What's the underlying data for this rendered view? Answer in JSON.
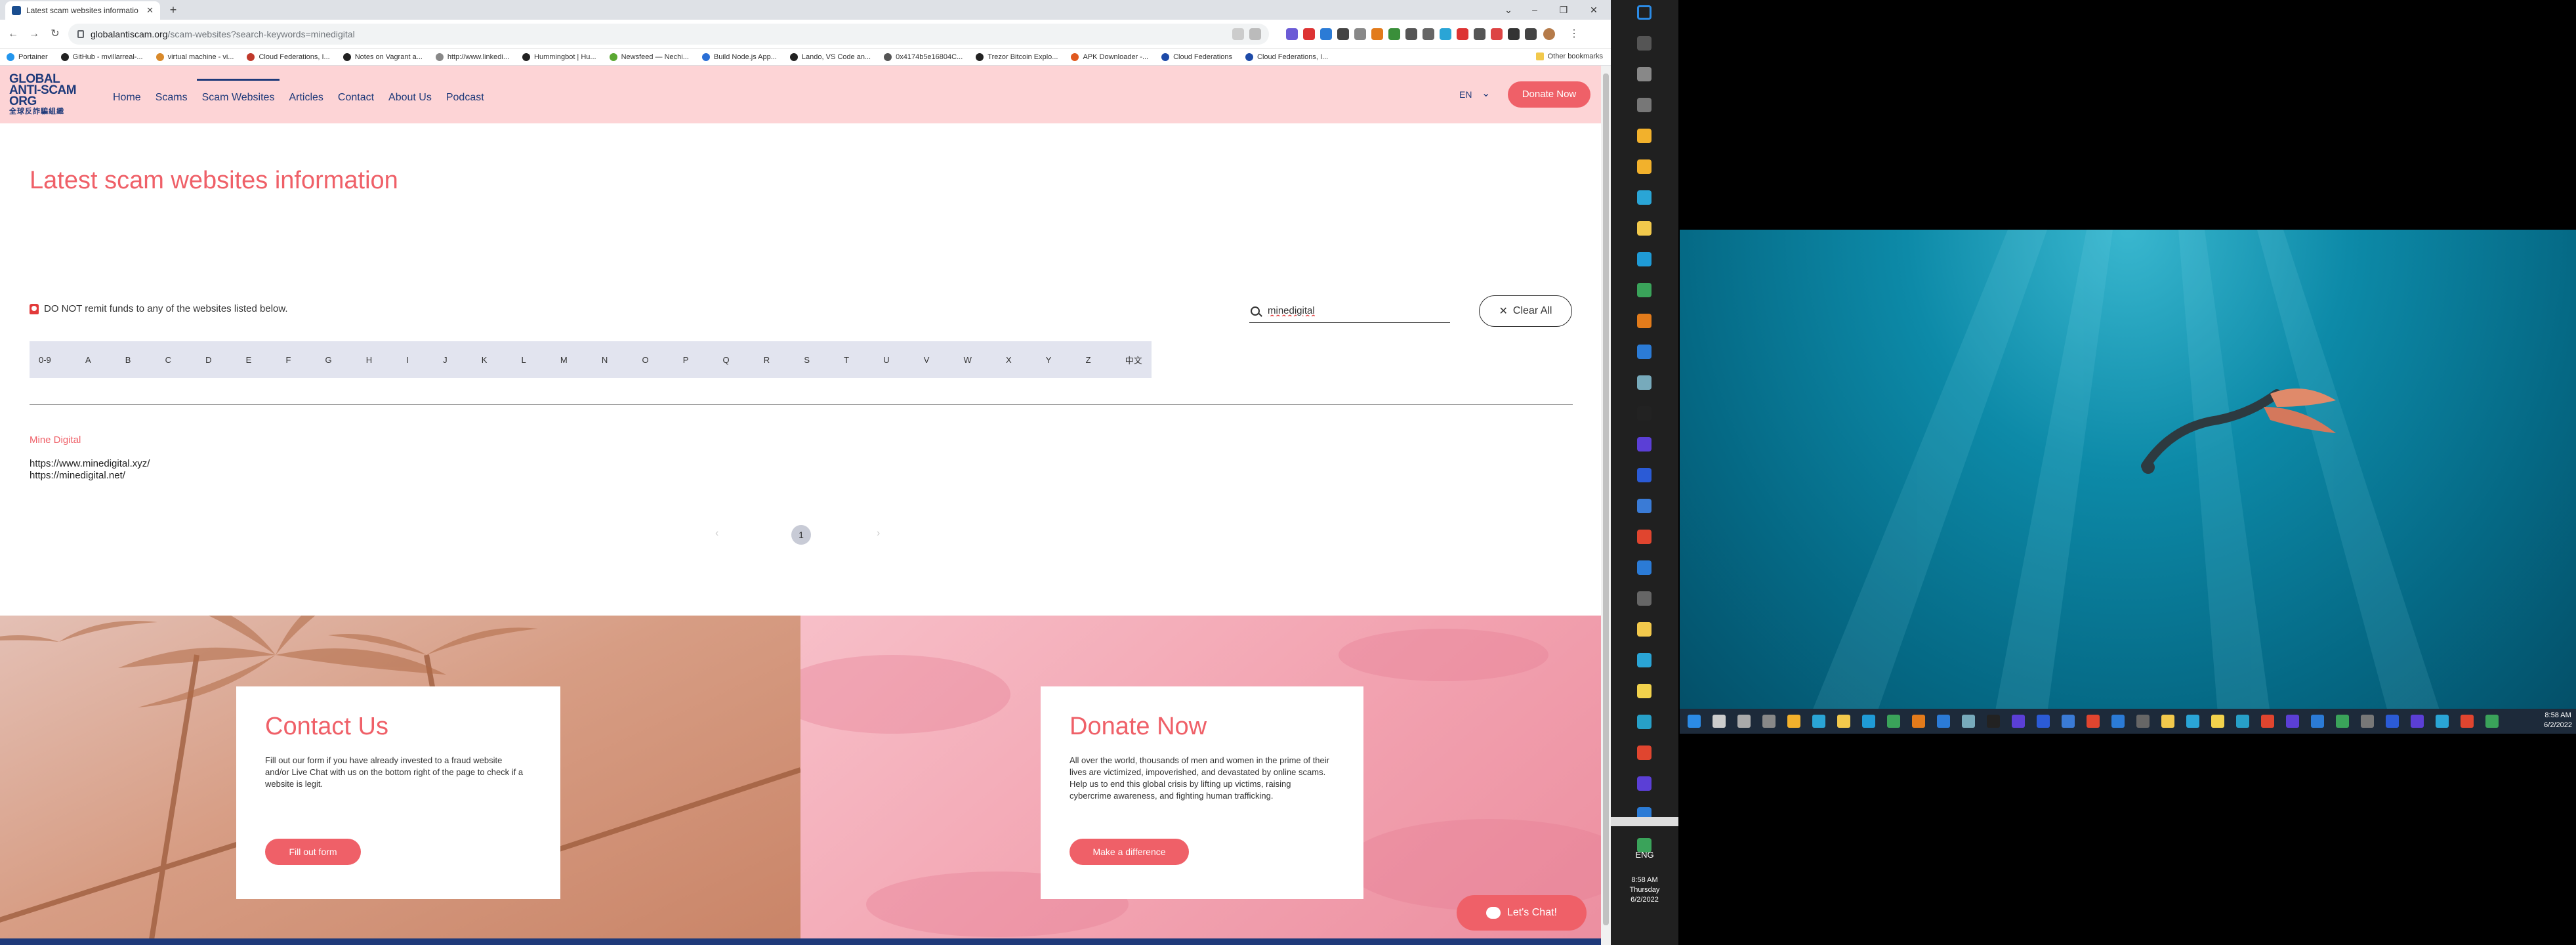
{
  "browser": {
    "tab_title": "Latest scam websites informatio",
    "url_host": "globalantiscam.org",
    "url_path": "/scam-websites?search-keywords=minedigital",
    "bookmarks": [
      "Portainer",
      "GitHub - mvillarreal-...",
      "virtual machine - vi...",
      "Cloud Federations, I...",
      "Notes on Vagrant a...",
      "http://www.linkedi...",
      "Hummingbot | Hu...",
      "Newsfeed — Nechi...",
      "Build Node.js App...",
      "Lando, VS Code an...",
      "0x4174b5e16804C...",
      "Trezor Bitcoin Explo...",
      "APK Downloader -...",
      "Cloud Federations",
      "Cloud Federations, I..."
    ],
    "bookmark_colors": [
      "#2396ed",
      "#222222",
      "#d98a2b",
      "#c0392b",
      "#222222",
      "#888888",
      "#222222",
      "#5aa832",
      "#2a6fd6",
      "#222222",
      "#555555",
      "#222222",
      "#e0591f",
      "#1d4aa8",
      "#1d4aa8"
    ],
    "other_bookmarks": "Other bookmarks"
  },
  "site": {
    "logo_line1": "GLOBAL",
    "logo_line2": "ANTI-SCAM",
    "logo_line3": "ORG",
    "logo_cn": "全球反詐騙組織",
    "nav": [
      "Home",
      "Scams",
      "Scam Websites",
      "Articles",
      "Contact",
      "About Us",
      "Podcast"
    ],
    "lang": "EN",
    "donate_now": "Donate Now"
  },
  "main": {
    "title": "Latest scam websites information",
    "warning": "DO NOT remit funds to any of the websites listed below.",
    "search_value": "minedigital",
    "clear_all": "Clear All",
    "alphabet": [
      "0-9",
      "A",
      "B",
      "C",
      "D",
      "E",
      "F",
      "G",
      "H",
      "I",
      "J",
      "K",
      "L",
      "M",
      "N",
      "O",
      "P",
      "Q",
      "R",
      "S",
      "T",
      "U",
      "V",
      "W",
      "X",
      "Y",
      "Z",
      "中文"
    ],
    "result": {
      "name": "Mine Digital",
      "urls": [
        "https://www.minedigital.xyz/",
        "https://minedigital.net/"
      ]
    },
    "page": "1"
  },
  "contact": {
    "title": "Contact Us",
    "text": "Fill out our form if you have already invested to a fraud website and/or Live Chat with us on the bottom right of the page to check if a website is legit.",
    "button": "Fill out form"
  },
  "donate": {
    "title": "Donate Now",
    "text": "All over the world, thousands of men and women in the prime of their lives are victimized, impoverished, and devastated by online scams. Help us to end this global crisis by lifting up victims, raising cybercrime awareness, and fighting human trafficking.",
    "button": "Make a difference"
  },
  "chat": {
    "label": "Let's Chat!"
  },
  "taskbar": {
    "lang": "ENG",
    "time": "8:58 AM",
    "day": "Thursday",
    "date": "6/2/2022"
  },
  "desktop": {
    "time": "8:58 AM",
    "date": "6/2/2022"
  },
  "colors": {
    "accent": "#ef6068",
    "header_bg": "#fdd4d6",
    "nav_text": "#1f3a7a",
    "alpha_bar": "#e2e4ef"
  }
}
